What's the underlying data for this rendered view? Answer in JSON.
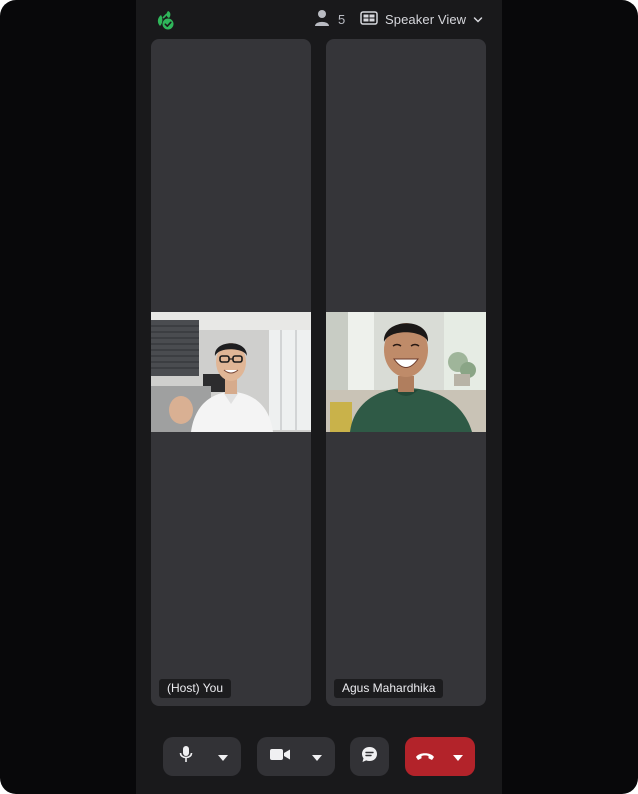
{
  "topbar": {
    "participant_count": "5",
    "view_label": "Speaker View"
  },
  "tiles": [
    {
      "name": "(Host) You"
    },
    {
      "name": "Agus Mahardhika"
    }
  ],
  "colors": {
    "brand": "#2fb65a",
    "end_call": "#b3232a",
    "tile_bg": "#353539",
    "app_bg": "#19191b"
  },
  "icons": {
    "logo": "app-logo-icon",
    "participants": "person-icon",
    "view": "grid-layout-icon",
    "mic": "microphone-icon",
    "camera": "video-camera-icon",
    "chat": "chat-bubble-icon",
    "end": "hang-up-icon"
  }
}
